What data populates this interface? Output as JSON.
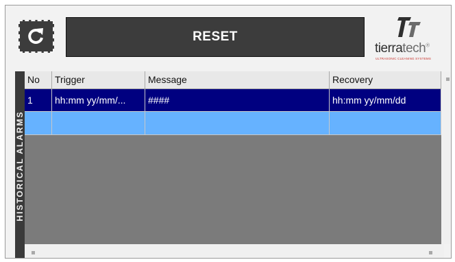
{
  "toolbar": {
    "refresh_icon": "refresh-icon",
    "reset_label": "RESET"
  },
  "logo": {
    "brand_part1": "tierra",
    "brand_part2": "tech",
    "registered": "®",
    "tagline": "ULTRASONIC CLEANING SYSTEMS"
  },
  "sidebar": {
    "label": "HISTORICAL ALARMS"
  },
  "table": {
    "columns": [
      "No",
      "Trigger",
      "Message",
      "Recovery"
    ],
    "rows": [
      {
        "no": "1",
        "trigger": "hh:mm yy/mm/...",
        "message": "####",
        "recovery": "hh:mm yy/mm/dd",
        "selected": true
      },
      {
        "no": "",
        "trigger": "",
        "message": "",
        "recovery": "",
        "selected": false
      }
    ]
  },
  "colors": {
    "selected_row": "#000080",
    "row_highlight": "#66b2ff",
    "empty_area": "#7b7b7b",
    "dark_button": "#3c3c3c",
    "logo_red": "#c8302a"
  }
}
